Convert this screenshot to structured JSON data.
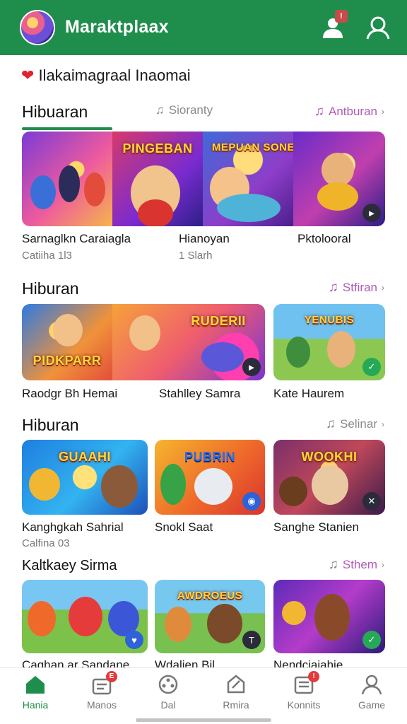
{
  "header": {
    "title": "Maraktplaax",
    "profile_badge": "!",
    "colors": {
      "bar": "#1f8e4c"
    }
  },
  "banner": {
    "text": "Ilakaimagraal Inaomai",
    "icon": "heart-icon"
  },
  "tabs": {
    "active": "Hibuaran",
    "middle": "Sioranty",
    "more": "Antburan"
  },
  "sections": [
    {
      "title": "Hibuaran",
      "items": [
        {
          "art": "PINGEBAN",
          "title": "Sarnaglkn Caraiagla",
          "subtitle": "Catiiha 1l3"
        },
        {
          "art": "MEPUAN SONEARS",
          "title": "Hianoyan",
          "subtitle": "1 Slarh"
        },
        {
          "art": "",
          "title": "Pktolooral",
          "subtitle": ""
        }
      ]
    },
    {
      "title": "Hiburan",
      "more": "Stfiran",
      "items": [
        {
          "art": "PIDKPARR",
          "title": "Raodgr Bh Hemai"
        },
        {
          "art": "RUDERII",
          "title": "Stahlley Samra"
        },
        {
          "art": "YENUBIS",
          "title": "Kate Haurem"
        }
      ]
    },
    {
      "title": "Hiburan",
      "more": "Selinar",
      "items": [
        {
          "art": "GUAAHI",
          "title": "Kanghgkah Sahrial",
          "subtitle": "Calfina 03"
        },
        {
          "art": "PUBRIN",
          "title": "Snokl Saat"
        },
        {
          "art": "WOOKHI",
          "title": "Sanghe Stanien"
        }
      ]
    },
    {
      "title": "Kaltkaey Sirma",
      "more": "Sthem",
      "items": [
        {
          "art": "",
          "title": "Caghan ar Sandane"
        },
        {
          "art": "AWDROEUS",
          "title": "Wdalien Bil"
        },
        {
          "art": "",
          "title": "Nendcjaiahie"
        }
      ]
    }
  ],
  "nav": [
    {
      "label": "Hania",
      "icon": "home-icon",
      "active": true
    },
    {
      "label": "Manos",
      "icon": "shop-icon",
      "badge": "E"
    },
    {
      "label": "Dal",
      "icon": "film-reel-icon"
    },
    {
      "label": "Rmira",
      "icon": "tag-icon"
    },
    {
      "label": "Konnits",
      "icon": "list-icon",
      "badge": "!"
    },
    {
      "label": "Game",
      "icon": "user-icon"
    }
  ]
}
